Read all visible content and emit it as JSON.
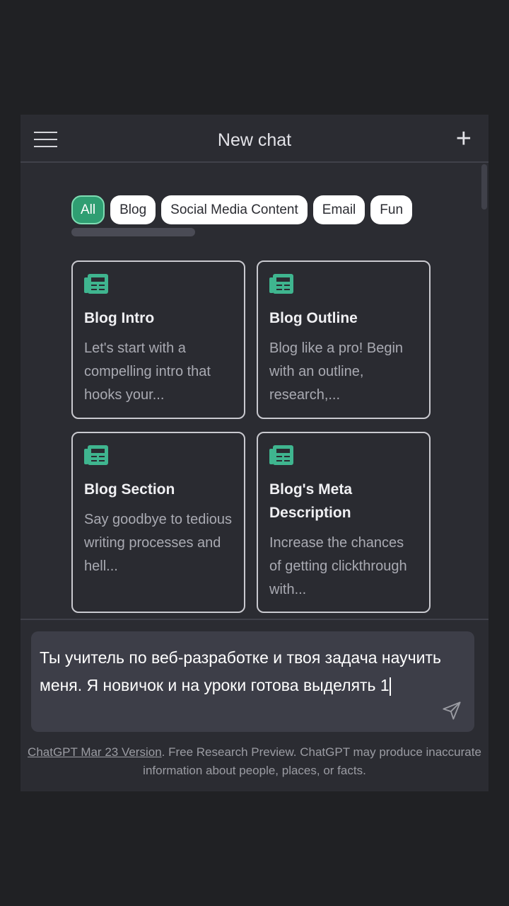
{
  "header": {
    "title": "New chat",
    "menu_icon": "hamburger-icon",
    "new_icon": "plus-icon"
  },
  "chips": [
    {
      "label": "All",
      "active": true
    },
    {
      "label": "Blog"
    },
    {
      "label": "Social Media Content"
    },
    {
      "label": "Email"
    },
    {
      "label": "Fun"
    }
  ],
  "cards": [
    {
      "title": "Blog Intro",
      "desc": "Let's start with a compelling intro that hooks your..."
    },
    {
      "title": "Blog Outline",
      "desc": "Blog like a pro! Begin with an outline, research,..."
    },
    {
      "title": "Blog Section",
      "desc": "Say goodbye to tedious writing processes and hell..."
    },
    {
      "title": "Blog's Meta Description",
      "desc": "Increase the chances of getting clickthrough with..."
    }
  ],
  "input": {
    "value": "Ты учитель по веб-разработке и твоя задача научить меня. Я новичок и на уроки готова выделять 1"
  },
  "footer": {
    "link": "ChatGPT Mar 23 Version",
    "text": ". Free Research Preview. ChatGPT may produce inaccurate information about people, places, or facts."
  },
  "colors": {
    "accent": "#2f9e72",
    "icon": "#3fb58f",
    "background": "#2b2c32"
  }
}
